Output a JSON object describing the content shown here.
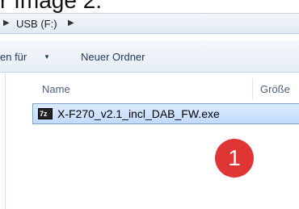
{
  "caption": "r Image 2:",
  "address": {
    "drive_label": "USB (F:)"
  },
  "toolbar": {
    "share_label": "en für",
    "new_folder_label": "Neuer Ordner"
  },
  "columns": {
    "name": "Name",
    "size": "Größe"
  },
  "files": [
    {
      "name": "X-F270_v2.1_incl_DAB_FW.exe",
      "icon": "7z-icon",
      "icon_text": "7z"
    }
  ],
  "annotation": {
    "number": "1",
    "color": "#e03535"
  }
}
